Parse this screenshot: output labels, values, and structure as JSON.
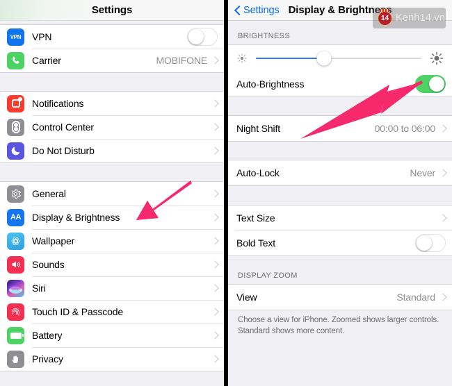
{
  "left_panel": {
    "nav": {
      "title": "Settings"
    },
    "groups": [
      {
        "rows": [
          {
            "label": "VPN",
            "icon": "vpn-icon",
            "accessory": "toggle",
            "toggle_on": false
          },
          {
            "label": "Carrier",
            "icon": "phone-icon",
            "accessory": "value-chevron",
            "value": "MOBIFONE"
          }
        ]
      },
      {
        "rows": [
          {
            "label": "Notifications",
            "icon": "notifications-icon",
            "accessory": "chevron"
          },
          {
            "label": "Control Center",
            "icon": "control-center-icon",
            "accessory": "chevron"
          },
          {
            "label": "Do Not Disturb",
            "icon": "moon-icon",
            "accessory": "chevron"
          }
        ]
      },
      {
        "rows": [
          {
            "label": "General",
            "icon": "gear-icon",
            "accessory": "chevron"
          },
          {
            "label": "Display & Brightness",
            "icon": "display-brightness-icon",
            "accessory": "chevron"
          },
          {
            "label": "Wallpaper",
            "icon": "wallpaper-icon",
            "accessory": "chevron"
          },
          {
            "label": "Sounds",
            "icon": "speaker-icon",
            "accessory": "chevron"
          },
          {
            "label": "Siri",
            "icon": "siri-icon",
            "accessory": "chevron"
          },
          {
            "label": "Touch ID & Passcode",
            "icon": "fingerprint-icon",
            "accessory": "chevron"
          },
          {
            "label": "Battery",
            "icon": "battery-icon",
            "accessory": "chevron"
          },
          {
            "label": "Privacy",
            "icon": "hand-icon",
            "accessory": "chevron"
          }
        ]
      }
    ]
  },
  "right_panel": {
    "nav": {
      "back_label": "Settings",
      "title": "Display & Brightness"
    },
    "brightness": {
      "section_header": "BRIGHTNESS",
      "slider_percent": 41,
      "low_icon": "sun-small-icon",
      "high_icon": "sun-large-icon",
      "auto_brightness": {
        "label": "Auto-Brightness",
        "toggle_on": true
      },
      "night_shift": {
        "label": "Night Shift",
        "value": "00:00 to 06:00"
      }
    },
    "auto_lock": {
      "label": "Auto-Lock",
      "value": "Never"
    },
    "text": {
      "text_size": {
        "label": "Text Size"
      },
      "bold_text": {
        "label": "Bold Text",
        "toggle_on": false
      }
    },
    "display_zoom": {
      "section_header": "DISPLAY ZOOM",
      "view": {
        "label": "View",
        "value": "Standard"
      },
      "footer": "Choose a view for iPhone. Zoomed shows larger controls. Standard shows more content."
    }
  },
  "watermark": {
    "badge": "14",
    "text": "Kenh14.vn"
  },
  "annotations": {
    "arrow_left": {
      "name": "pink-arrow-display-brightness",
      "color": "#f5296b"
    },
    "arrow_right": {
      "name": "pink-arrow-auto-brightness",
      "color": "#f5296b"
    }
  },
  "colors": {
    "accent_blue": "#0b6cf5",
    "toggle_green": "#4cd364",
    "slider_blue": "#3478f6",
    "arrow_pink": "#f5296b",
    "group_bg": "#efeff4"
  }
}
